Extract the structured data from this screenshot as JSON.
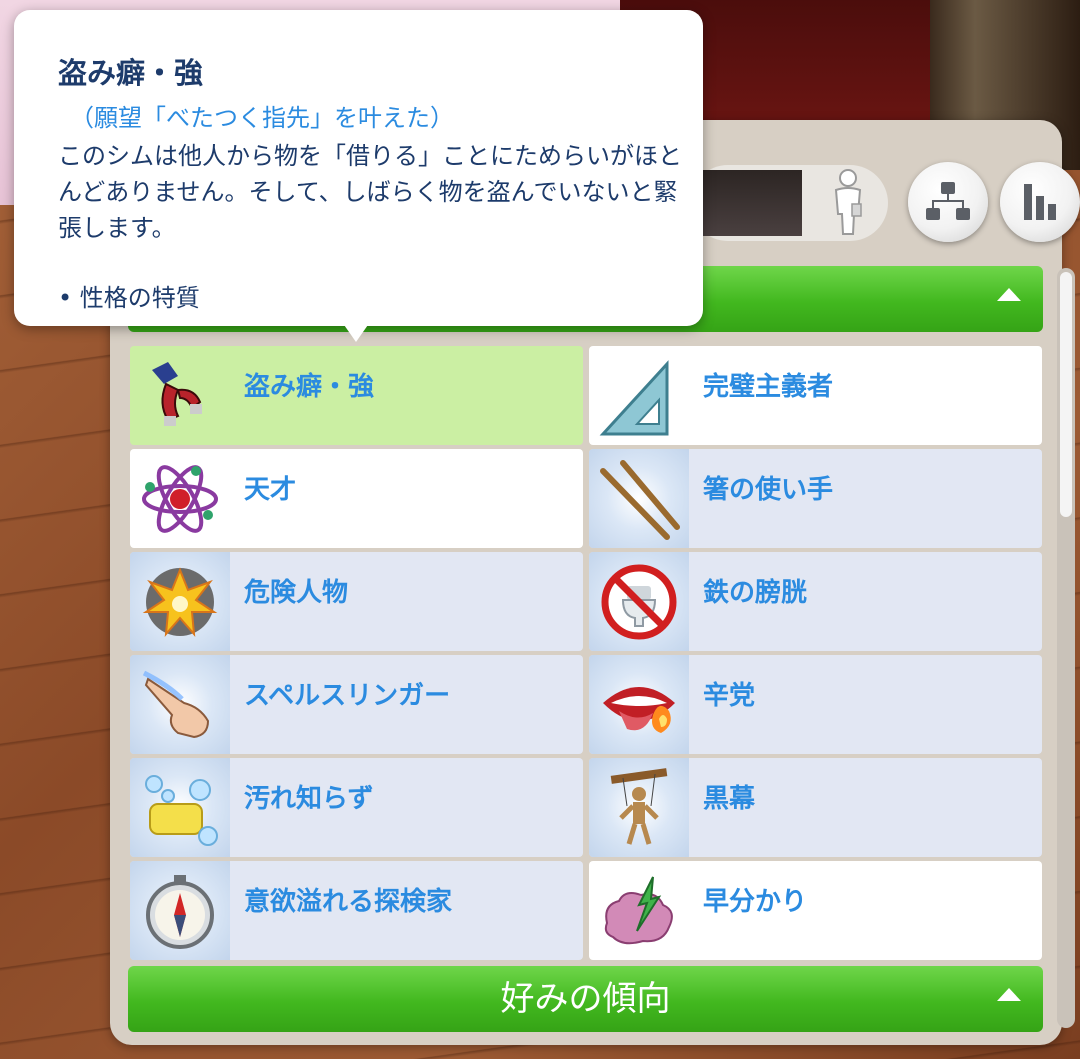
{
  "tooltip": {
    "title": "盗み癖・強",
    "subtitle": "（願望「べたつく指先」を叶えた）",
    "description": "このシムは他人から物を「借りる」ことにためらいがほとんどありません。そして、しばらく物を盗んでいないと緊張します。",
    "category": "• 性格の特質"
  },
  "top_section": {
    "label": ""
  },
  "traits": [
    {
      "label": "盗み癖・強",
      "icon": "grabber-claw-icon",
      "state": "selected"
    },
    {
      "label": "完璧主義者",
      "icon": "set-square-icon",
      "state": "plain"
    },
    {
      "label": "天才",
      "icon": "atom-icon",
      "state": "plain"
    },
    {
      "label": "箸の使い手",
      "icon": "chopsticks-icon",
      "state": "reward"
    },
    {
      "label": "危険人物",
      "icon": "explosion-icon",
      "state": "reward"
    },
    {
      "label": "鉄の膀胱",
      "icon": "no-toilet-icon",
      "state": "reward"
    },
    {
      "label": "スペルスリンガー",
      "icon": "magic-finger-icon",
      "state": "reward"
    },
    {
      "label": "辛党",
      "icon": "spicy-mouth-icon",
      "state": "reward"
    },
    {
      "label": "汚れ知らず",
      "icon": "soap-bubbles-icon",
      "state": "reward"
    },
    {
      "label": "黒幕",
      "icon": "marionette-icon",
      "state": "reward"
    },
    {
      "label": "意欲溢れる探検家",
      "icon": "compass-icon",
      "state": "reward"
    },
    {
      "label": "早分かり",
      "icon": "brain-arrow-icon",
      "state": "reward"
    }
  ],
  "bottom_section": {
    "label": "好みの傾向"
  },
  "toolbar": {
    "family_tree_icon": "family-tree-icon",
    "stats_icon": "stats-icon",
    "person_icon": "person-icon"
  },
  "colors": {
    "accent_green": "#42b81f",
    "trait_text_blue": "#2b8be0",
    "tooltip_text_navy": "#1d3b6b",
    "selected_row_green": "#cbefa3"
  }
}
